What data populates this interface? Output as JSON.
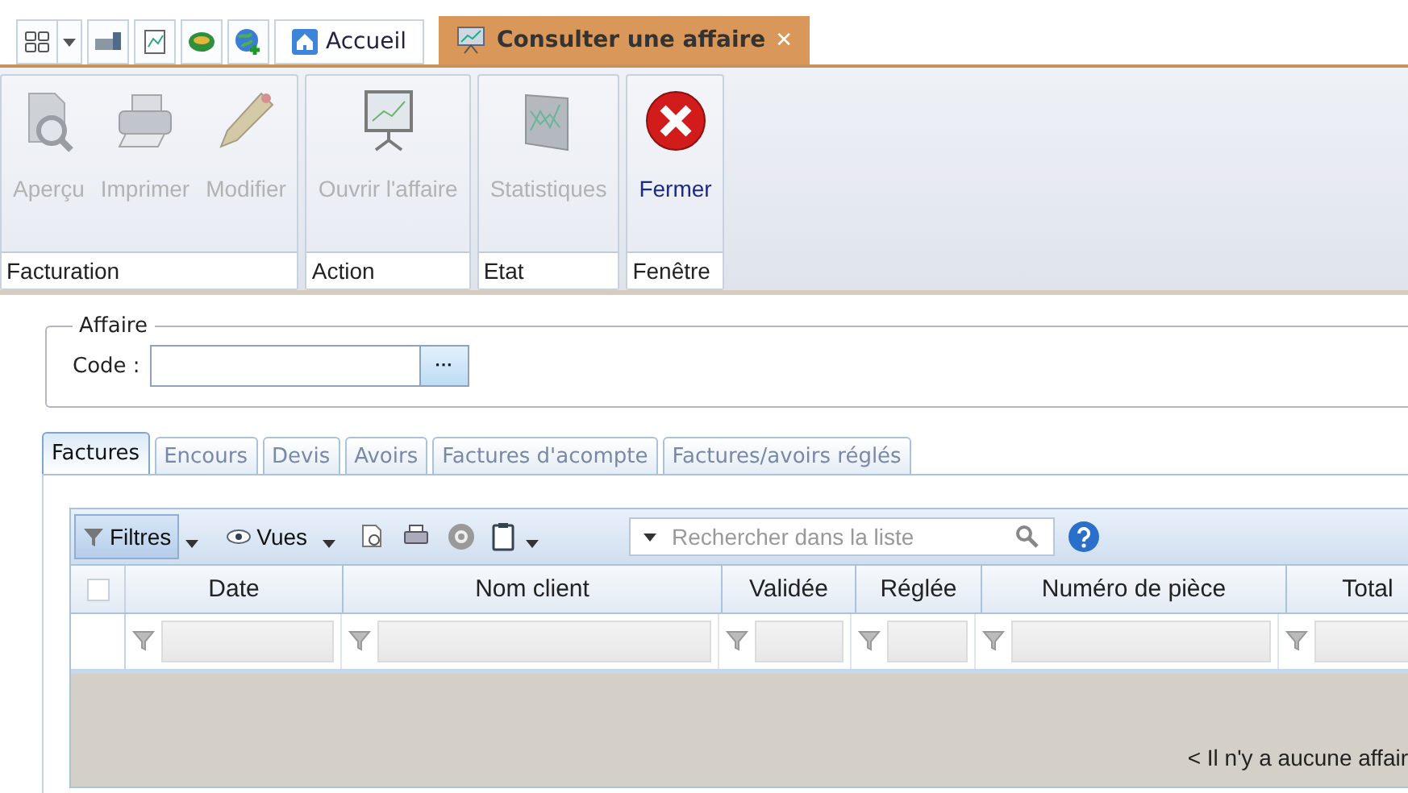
{
  "quick_bar": {
    "home_label": "Accueil"
  },
  "doc_tab": {
    "title": "Consulter une affaire",
    "close": "✕",
    "selected": true
  },
  "ribbon": [
    {
      "group": "Facturation",
      "buttons": [
        {
          "label": "Aperçu",
          "kind": "preview",
          "disabled": true
        },
        {
          "label": "Imprimer",
          "kind": "printer",
          "disabled": true
        },
        {
          "label": "Modifier",
          "kind": "pencil",
          "disabled": true
        }
      ]
    },
    {
      "group": "Action",
      "buttons": [
        {
          "label": "Ouvrir l'affaire",
          "kind": "board",
          "disabled": true
        }
      ]
    },
    {
      "group": "Etat",
      "buttons": [
        {
          "label": "Statistiques",
          "kind": "chart",
          "disabled": true
        }
      ]
    },
    {
      "group": "Fenêtre",
      "buttons": [
        {
          "label": "Fermer",
          "kind": "close",
          "disabled": false
        }
      ]
    }
  ],
  "affaire": {
    "legend": "Affaire",
    "code_label": "Code :",
    "browse": "···"
  },
  "tabs": [
    {
      "label": "Factures",
      "selected": true
    },
    {
      "label": "Encours",
      "selected": false
    },
    {
      "label": "Devis",
      "selected": false
    },
    {
      "label": "Avoirs",
      "selected": false
    },
    {
      "label": "Factures d'acompte",
      "selected": false
    },
    {
      "label": "Factures/avoirs réglés",
      "selected": false
    }
  ],
  "toolbar": {
    "filters": "Filtres",
    "views": "Vues",
    "search_placeholder": "Rechercher dans la liste"
  },
  "table": {
    "select_all_checked": false,
    "columns": [
      "Date",
      "Nom client",
      "Validée",
      "Réglée",
      "Numéro de pièce",
      "Total"
    ],
    "empty_message": "< Il n'y a aucune affair"
  }
}
